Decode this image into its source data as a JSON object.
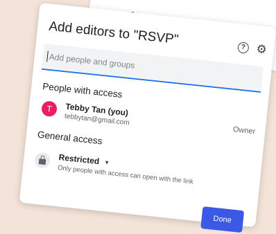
{
  "background_card": {
    "label": "Add co"
  },
  "dialog": {
    "title": "Add editors to \"RSVP\"",
    "help_icon_glyph": "?",
    "gear_icon_glyph": "⚙",
    "input": {
      "placeholder": "Add people and groups"
    },
    "people_section_title": "People with access",
    "people": [
      {
        "avatar_letter": "T",
        "name": "Tebby Tan (you)",
        "email": "tebbytan@gmail.com",
        "role": "Owner"
      }
    ],
    "general_access_title": "General access",
    "general_access": {
      "selected": "Restricted",
      "description": "Only people with access can open with the link"
    },
    "done_label": "Done"
  },
  "colors": {
    "accent": "#1a73e8",
    "done_button": "#3c59e6",
    "avatar": "#e91e63",
    "background": "#f3e3d8"
  }
}
